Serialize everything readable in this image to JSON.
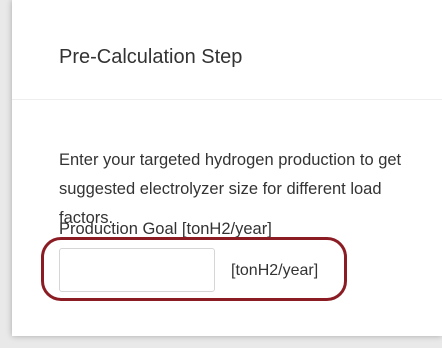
{
  "card": {
    "title": "Pre-Calculation Step",
    "description": "Enter your targeted hydrogen production to get suggested electrolyzer size for different load factors.",
    "goal_label": "Production Goal [tonH2/year]",
    "goal_input_value": "",
    "goal_unit": "[tonH2/year]"
  },
  "colors": {
    "highlight_border": "#8b1c24",
    "text": "#333333",
    "background": "#e9e9e9",
    "card": "#ffffff"
  }
}
